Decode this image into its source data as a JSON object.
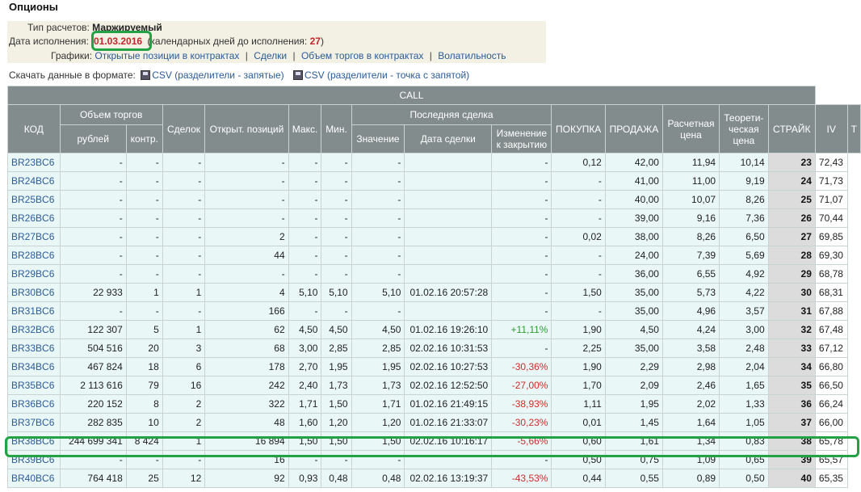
{
  "title": "Опционы",
  "info": {
    "calc_type_label": "Тип расчетов:",
    "calc_type_value": "Маржируемый",
    "exp_label": "Дата исполнения:",
    "exp_date": "01.03.2016",
    "days_label_open": "(календарных дней до исполнения:",
    "days_value": "27",
    "days_label_close": ")",
    "charts_label": "Графики:",
    "charts_links": [
      "Открытые позиции в контрактах",
      "Сделки",
      "Объем торгов в контрактах",
      "Волатильность"
    ],
    "chart_sep": "|"
  },
  "download": {
    "label": "Скачать данные в формате:",
    "csv1": "CSV (разделители - запятые)",
    "csv2": "CSV (разделители - точка с запятой)"
  },
  "table": {
    "group_title": "CALL",
    "h": {
      "code": "КОД",
      "volume": "Объем торгов",
      "rub": "рублей",
      "contracts": "контр.",
      "deals": "Сделок",
      "open_pos": "Открыт. позиций",
      "max": "Макс.",
      "min": "Мин.",
      "last_deal": "Последняя сделка",
      "value": "Значение",
      "deal_date": "Дата сделки",
      "change": "Изменение к закрытию",
      "buy": "ПОКУПКА",
      "sell": "ПРОДАЖА",
      "calc_price": "Расчетная цена",
      "theo_price": "Теорети-ческая цена",
      "strike": "СТРАЙК",
      "iv": "IV",
      "extra": "T"
    },
    "rows": [
      {
        "code": "BR23BC6",
        "rub": "-",
        "contr": "-",
        "deals": "-",
        "oi": "-",
        "max": "-",
        "min": "-",
        "val": "-",
        "date": "",
        "chg": "-",
        "buy": "0,12",
        "sell": "42,00",
        "calc": "11,94",
        "theo": "10,14",
        "strike": "23",
        "iv": "72,43"
      },
      {
        "code": "BR24BC6",
        "rub": "-",
        "contr": "-",
        "deals": "-",
        "oi": "-",
        "max": "-",
        "min": "-",
        "val": "-",
        "date": "",
        "chg": "-",
        "buy": "-",
        "sell": "41,00",
        "calc": "11,00",
        "theo": "9,19",
        "strike": "24",
        "iv": "71,73"
      },
      {
        "code": "BR25BC6",
        "rub": "-",
        "contr": "-",
        "deals": "-",
        "oi": "-",
        "max": "-",
        "min": "-",
        "val": "-",
        "date": "",
        "chg": "-",
        "buy": "-",
        "sell": "40,00",
        "calc": "10,07",
        "theo": "8,26",
        "strike": "25",
        "iv": "71,07"
      },
      {
        "code": "BR26BC6",
        "rub": "-",
        "contr": "-",
        "deals": "-",
        "oi": "-",
        "max": "-",
        "min": "-",
        "val": "-",
        "date": "",
        "chg": "-",
        "buy": "-",
        "sell": "39,00",
        "calc": "9,16",
        "theo": "7,36",
        "strike": "26",
        "iv": "70,44"
      },
      {
        "code": "BR27BC6",
        "rub": "-",
        "contr": "-",
        "deals": "-",
        "oi": "2",
        "max": "-",
        "min": "-",
        "val": "-",
        "date": "",
        "chg": "-",
        "buy": "0,02",
        "sell": "38,00",
        "calc": "8,26",
        "theo": "6,50",
        "strike": "27",
        "iv": "69,85"
      },
      {
        "code": "BR28BC6",
        "rub": "-",
        "contr": "-",
        "deals": "-",
        "oi": "44",
        "max": "-",
        "min": "-",
        "val": "-",
        "date": "",
        "chg": "-",
        "buy": "-",
        "sell": "24,00",
        "calc": "7,39",
        "theo": "5,69",
        "strike": "28",
        "iv": "69,30"
      },
      {
        "code": "BR29BC6",
        "rub": "-",
        "contr": "-",
        "deals": "-",
        "oi": "-",
        "max": "-",
        "min": "-",
        "val": "-",
        "date": "",
        "chg": "-",
        "buy": "-",
        "sell": "36,00",
        "calc": "6,55",
        "theo": "4,92",
        "strike": "29",
        "iv": "68,78"
      },
      {
        "code": "BR30BC6",
        "rub": "22 933",
        "contr": "1",
        "deals": "1",
        "oi": "4",
        "max": "5,10",
        "min": "5,10",
        "val": "5,10",
        "date": "01.02.16 20:57:28",
        "chg": "-",
        "buy": "1,50",
        "sell": "35,00",
        "calc": "5,73",
        "theo": "4,22",
        "strike": "30",
        "iv": "68,31"
      },
      {
        "code": "BR31BC6",
        "rub": "-",
        "contr": "-",
        "deals": "-",
        "oi": "166",
        "max": "-",
        "min": "-",
        "val": "-",
        "date": "",
        "chg": "-",
        "buy": "-",
        "sell": "35,00",
        "calc": "4,96",
        "theo": "3,57",
        "strike": "31",
        "iv": "67,88"
      },
      {
        "code": "BR32BC6",
        "rub": "122 307",
        "contr": "5",
        "deals": "1",
        "oi": "62",
        "max": "4,50",
        "min": "4,50",
        "val": "4,50",
        "date": "01.02.16 19:26:10",
        "chg": "+11,11%",
        "cls": "pos",
        "buy": "1,90",
        "sell": "4,50",
        "calc": "4,24",
        "theo": "3,00",
        "strike": "32",
        "iv": "67,48"
      },
      {
        "code": "BR33BC6",
        "rub": "504 516",
        "contr": "20",
        "deals": "3",
        "oi": "68",
        "max": "3,00",
        "min": "2,85",
        "val": "2,85",
        "date": "02.02.16 10:31:53",
        "chg": "-",
        "buy": "2,25",
        "sell": "35,00",
        "calc": "3,58",
        "theo": "2,48",
        "strike": "33",
        "iv": "67,12"
      },
      {
        "code": "BR34BC6",
        "rub": "467 824",
        "contr": "18",
        "deals": "6",
        "oi": "178",
        "max": "2,70",
        "min": "1,95",
        "val": "1,95",
        "date": "02.02.16 10:27:53",
        "chg": "-30,36%",
        "cls": "neg",
        "buy": "1,90",
        "sell": "2,29",
        "calc": "2,98",
        "theo": "2,04",
        "strike": "34",
        "iv": "66,80"
      },
      {
        "code": "BR35BC6",
        "rub": "2 113 616",
        "contr": "79",
        "deals": "16",
        "oi": "242",
        "max": "2,40",
        "min": "1,73",
        "val": "1,73",
        "date": "02.02.16 12:52:50",
        "chg": "-27,00%",
        "cls": "neg",
        "buy": "1,70",
        "sell": "2,09",
        "calc": "2,46",
        "theo": "1,65",
        "strike": "35",
        "iv": "66,50"
      },
      {
        "code": "BR36BC6",
        "rub": "220 152",
        "contr": "8",
        "deals": "2",
        "oi": "322",
        "max": "1,71",
        "min": "1,50",
        "val": "1,71",
        "date": "01.02.16 21:49:15",
        "chg": "-38,93%",
        "cls": "neg",
        "buy": "1,11",
        "sell": "1,95",
        "calc": "2,02",
        "theo": "1,33",
        "strike": "36",
        "iv": "66,24"
      },
      {
        "code": "BR37BC6",
        "rub": "282 835",
        "contr": "10",
        "deals": "2",
        "oi": "48",
        "max": "1,60",
        "min": "1,20",
        "val": "1,20",
        "date": "01.02.16 21:33:07",
        "chg": "-30,23%",
        "cls": "neg",
        "buy": "0,01",
        "sell": "1,45",
        "calc": "1,64",
        "theo": "1,05",
        "strike": "37",
        "iv": "66,00"
      },
      {
        "code": "BR38BC6",
        "rub": "244 699 341",
        "contr": "8 424",
        "deals": "1",
        "oi": "16 894",
        "max": "1,50",
        "min": "1,50",
        "val": "1,50",
        "date": "02.02.16 10:16:17",
        "chg": "-5,66%",
        "cls": "neg",
        "buy": "0,60",
        "sell": "1,61",
        "calc": "1,34",
        "theo": "0,83",
        "strike": "38",
        "iv": "65,78"
      },
      {
        "code": "BR39BC6",
        "rub": "-",
        "contr": "-",
        "deals": "-",
        "oi": "16",
        "max": "-",
        "min": "-",
        "val": "-",
        "date": "",
        "chg": "-",
        "buy": "0,50",
        "sell": "0,75",
        "calc": "1,09",
        "theo": "0,65",
        "strike": "39",
        "iv": "65,57"
      },
      {
        "code": "BR40BC6",
        "rub": "764 418",
        "contr": "25",
        "deals": "12",
        "oi": "92",
        "max": "0,93",
        "min": "0,48",
        "val": "0,48",
        "date": "02.02.16 13:19:37",
        "chg": "-43,53%",
        "cls": "neg",
        "buy": "0,44",
        "sell": "0,55",
        "calc": "0,89",
        "theo": "0,50",
        "strike": "40",
        "iv": "65,35"
      }
    ]
  }
}
